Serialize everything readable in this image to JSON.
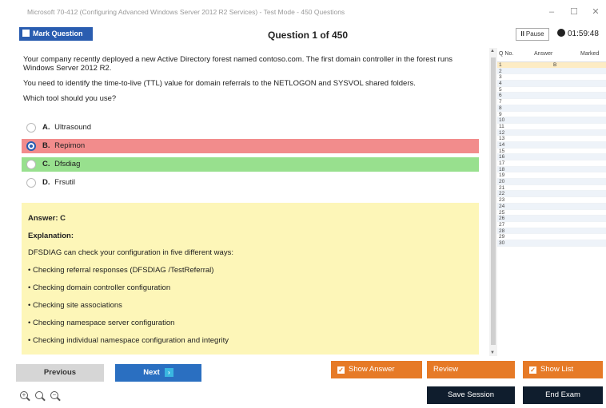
{
  "window": {
    "title": "Microsoft 70-412 (Configuring Advanced Windows Server 2012 R2 Services) - Test Mode - 450 Questions",
    "minimize": "–",
    "maximize": "☐",
    "close": "✕"
  },
  "header": {
    "mark_label": "Mark Question",
    "question_counter": "Question 1 of 450",
    "pause_label": "Pause",
    "timer": "01:59:48"
  },
  "question": {
    "paragraphs": [
      "Your company recently deployed a new Active Directory forest named contoso.com. The first domain controller in the forest runs Windows Server 2012 R2.",
      "You need to identify the time-to-live (TTL) value for domain referrals to the NETLOGON and SYSVOL shared folders.",
      "Which tool should you use?"
    ],
    "options": [
      {
        "letter": "A.",
        "text": "Ultrasound",
        "state": "none"
      },
      {
        "letter": "B.",
        "text": "Repimon",
        "state": "wrong"
      },
      {
        "letter": "C.",
        "text": "Dfsdiag",
        "state": "correct"
      },
      {
        "letter": "D.",
        "text": "Frsutil",
        "state": "none"
      }
    ]
  },
  "explanation": {
    "answer": "Answer: C",
    "heading": "Explanation:",
    "intro": "DFSDIAG can check your configuration in five different ways:",
    "bullets": [
      "• Checking referral responses (DFSDIAG /TestReferral)",
      "• Checking domain controller configuration",
      "• Checking site associations",
      "• Checking namespace server configuration",
      "• Checking individual namespace configuration and integrity"
    ]
  },
  "question_list": {
    "headers": {
      "qno": "Q No.",
      "answer": "Answer",
      "marked": "Marked"
    },
    "answered": {
      "q": "1",
      "answer": "B"
    },
    "numbers": [
      "1",
      "2",
      "3",
      "4",
      "5",
      "6",
      "7",
      "8",
      "9",
      "10",
      "11",
      "12",
      "13",
      "14",
      "15",
      "16",
      "17",
      "18",
      "19",
      "20",
      "21",
      "22",
      "23",
      "24",
      "25",
      "26",
      "27",
      "28",
      "29",
      "30"
    ]
  },
  "footer": {
    "previous": "Previous",
    "next": "Next",
    "show_answer": "Show Answer",
    "review": "Review",
    "show_list": "Show List",
    "save_session": "Save Session",
    "end_exam": "End Exam"
  },
  "colors": {
    "accent_blue": "#2a5db0",
    "wrong_red": "#f28c8c",
    "correct_green": "#98e08e",
    "explanation_yellow": "#fdf6b8",
    "orange": "#e67a27",
    "dark": "#0f1d2d"
  }
}
